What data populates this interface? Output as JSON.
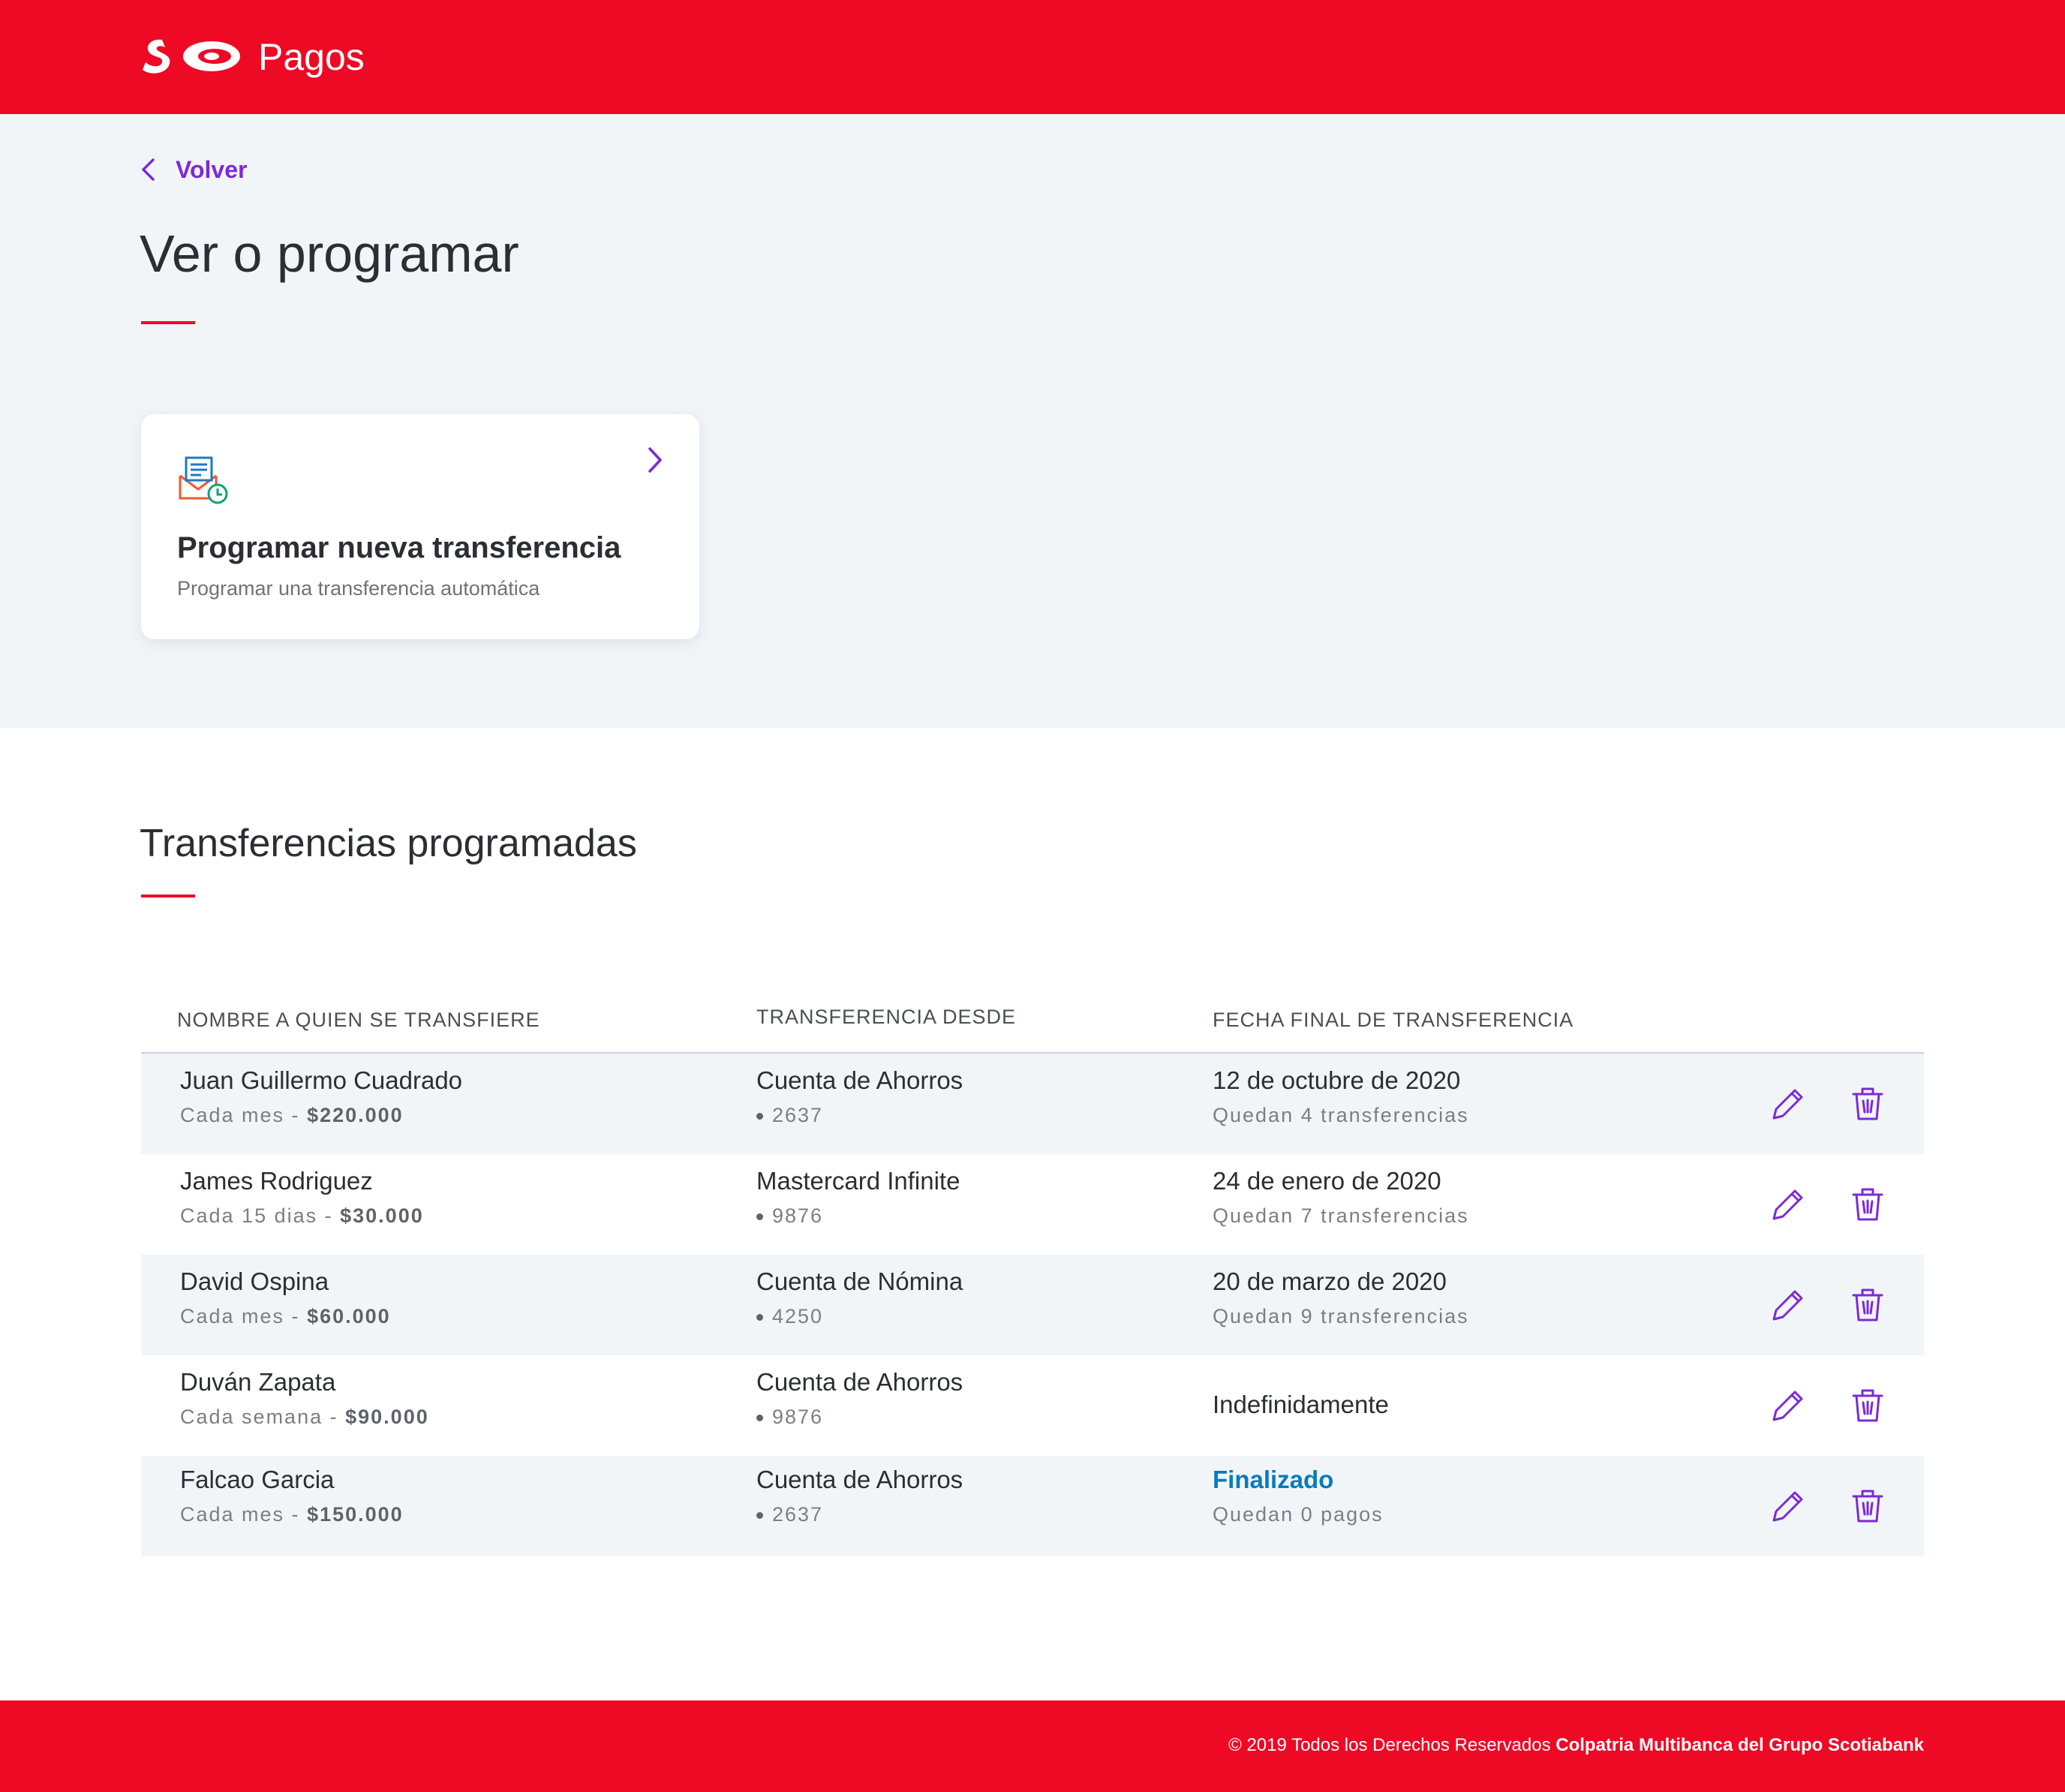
{
  "header": {
    "title": "Pagos"
  },
  "nav": {
    "back_label": "Volver"
  },
  "page": {
    "title": "Ver o programar"
  },
  "card": {
    "title": "Programar nueva transferencia",
    "description": "Programar una transferencia automática"
  },
  "scheduled": {
    "title": "Transferencias programadas",
    "columns": [
      "NOMBRE A QUIEN SE TRANSFIERE",
      "TRANSFERENCIA DESDE",
      "FECHA FINAL DE TRANSFERENCIA"
    ],
    "rows": [
      {
        "name": "Juan Guillermo Cuadrado",
        "frequency": "Cada mes -",
        "amount": "$220.000",
        "account": "Cuenta de Ahorros",
        "account_number": "2637",
        "end_date": "12 de octubre de 2020",
        "remaining": "Quedan 4 transferencias"
      },
      {
        "name": "James Rodriguez",
        "frequency": "Cada 15 dias -",
        "amount": "$30.000",
        "account": "Mastercard Infinite",
        "account_number": "9876",
        "end_date": "24 de enero de 2020",
        "remaining": "Quedan 7 transferencias"
      },
      {
        "name": "David Ospina",
        "frequency": "Cada mes -",
        "amount": "$60.000",
        "account": "Cuenta de Nómina",
        "account_number": "4250",
        "end_date": "20 de marzo de 2020",
        "remaining": "Quedan 9 transferencias"
      },
      {
        "name": "Duván Zapata",
        "frequency": "Cada semana -",
        "amount": "$90.000",
        "account": "Cuenta de Ahorros",
        "account_number": "9876",
        "end_date": "Indefinidamente",
        "remaining": ""
      },
      {
        "name": "Falcao Garcia",
        "frequency": "Cada mes -",
        "amount": "$150.000",
        "account": "Cuenta de Ahorros",
        "account_number": "2637",
        "end_date": "Finalizado",
        "remaining": "Quedan 0 pagos"
      }
    ]
  },
  "footer": {
    "copyright": "© 2019 Todos los Derechos Reservados",
    "company": "Colpatria Multibanca del Grupo Scotiabank"
  },
  "colors": {
    "brand_red": "#ee0925",
    "accent_purple": "#7c2ad8",
    "status_blue": "#0a7bbd",
    "section_gray": "#f2f5f8"
  },
  "icons": {
    "logo": "scotiabank-logo",
    "back": "chevron-left-icon",
    "card": "scheduled-transfer-icon",
    "card_chevron": "chevron-right-icon",
    "edit": "pencil-icon",
    "delete": "trash-icon"
  }
}
